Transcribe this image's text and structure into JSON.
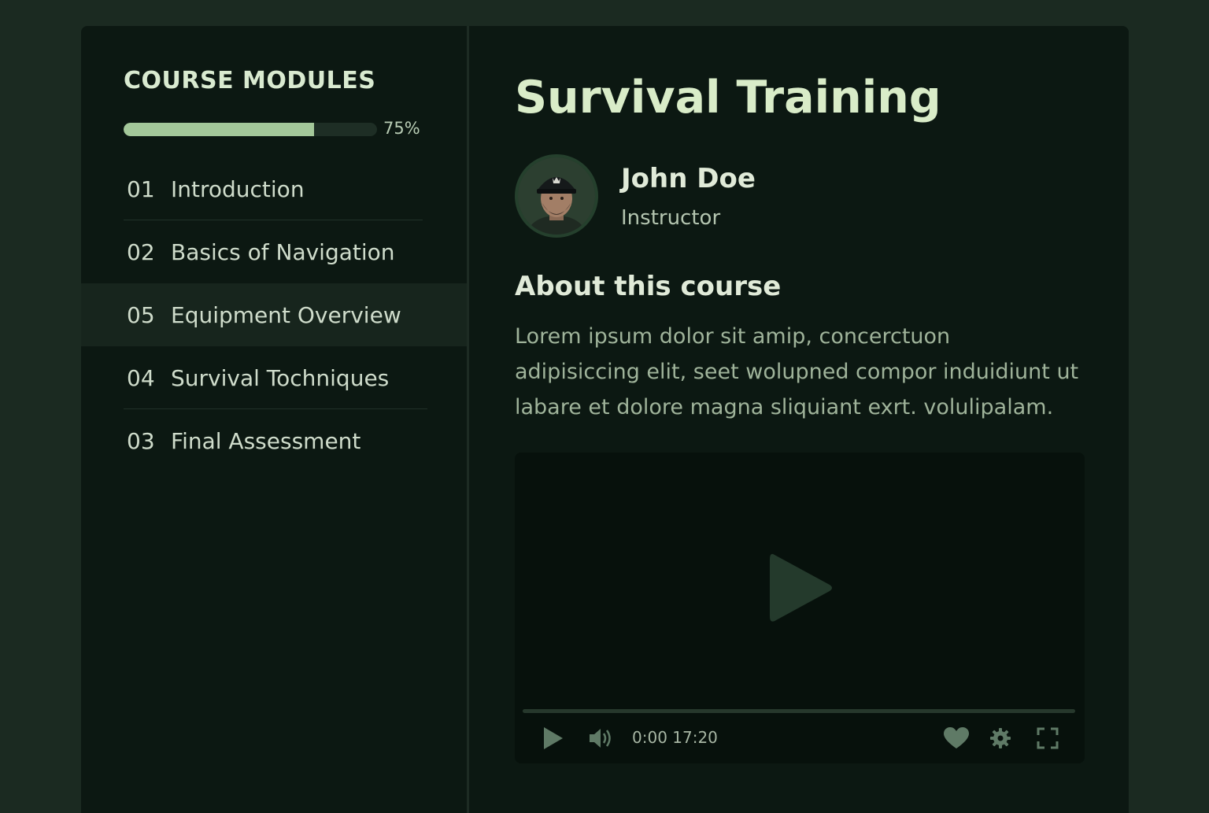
{
  "sidebar": {
    "title": "COURSE MODULES",
    "progress": {
      "percent": 75,
      "label": "75%"
    },
    "modules": [
      {
        "num": "01",
        "label": "Introduction",
        "active": false
      },
      {
        "num": "02",
        "label": "Basics of Navigation",
        "active": false
      },
      {
        "num": "05",
        "label": "Equipment Overview",
        "active": true
      },
      {
        "num": "04",
        "label": "Survival Tochniques",
        "active": false
      },
      {
        "num": "03",
        "label": "Final Assessment",
        "active": false
      }
    ]
  },
  "main": {
    "title": "Survival Training",
    "instructor": {
      "name": "John Doe",
      "role": "Instructor"
    },
    "about": {
      "heading": "About this course",
      "text": "Lorem ipsum dolor sit amip, concerctuon adipisiccing elit, seet wolupned compor induidiunt ut labare et dolore magna sliquiant exrt. volulipalam."
    },
    "video": {
      "time": "0:00 17:20",
      "progress": 0
    }
  },
  "colors": {
    "background": "#1b2a21",
    "panel": "#0c1812",
    "accent": "#a4c89a",
    "active_row": "#17251d"
  },
  "icons": [
    "play-icon",
    "volume-icon",
    "heart-icon",
    "settings-gear-icon",
    "fullscreen-icon"
  ]
}
